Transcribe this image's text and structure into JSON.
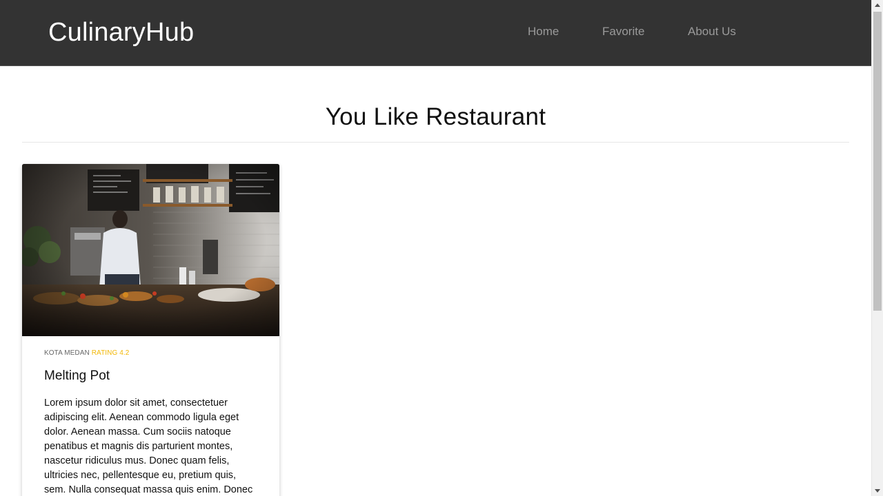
{
  "header": {
    "brand": "CulinaryHub",
    "nav": [
      {
        "label": "Home"
      },
      {
        "label": "Favorite"
      },
      {
        "label": "About Us"
      }
    ]
  },
  "main": {
    "title": "You Like Restaurant",
    "restaurants": [
      {
        "city": "KOTA MEDAN",
        "rating_label": "RATING 4.2",
        "name": "Melting Pot",
        "description": "Lorem ipsum dolor sit amet, consectetuer adipiscing elit. Aenean commodo ligula eget dolor. Aenean massa. Cum sociis natoque penatibus et magnis dis parturient montes, nascetur ridiculus mus. Donec quam felis, ultricies nec, pellentesque eu, pretium quis, sem. Nulla consequat massa quis enim. Donec"
      }
    ]
  },
  "colors": {
    "header_bg": "#333333",
    "rating_accent": "#f2b705"
  }
}
